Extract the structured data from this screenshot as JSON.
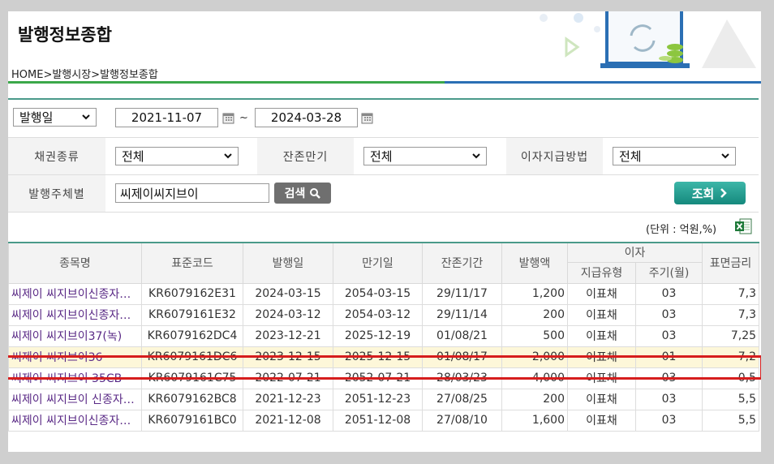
{
  "header": {
    "title": "발행정보종합",
    "breadcrumb": "HOME>발행시장>발행정보종합"
  },
  "filters": {
    "date_type": "발행일",
    "date_from": "2021-11-07",
    "date_sep": "~",
    "date_to": "2024-03-28",
    "bond_type_label": "채권종류",
    "bond_type_value": "전체",
    "remaining_label": "잔존만기",
    "remaining_value": "전체",
    "interest_method_label": "이자지급방법",
    "interest_method_value": "전체",
    "issuer_label": "발행주체별",
    "issuer_value": "씨제이씨지브이",
    "search_label": "검색",
    "query_label": "조회"
  },
  "unit_text": "(단위 : 억원,%)",
  "table": {
    "headers": {
      "name": "종목명",
      "code": "표준코드",
      "issue_date": "발행일",
      "maturity": "만기일",
      "remaining": "잔존기간",
      "amount": "발행액",
      "interest": "이자",
      "pay_type": "지급유형",
      "cycle": "주기(월)",
      "coupon": "표면금리"
    },
    "rows": [
      {
        "name": "씨제이 씨지브이신종자본증권",
        "code": "KR6079162E31",
        "issue_date": "2024-03-15",
        "maturity": "2054-03-15",
        "remaining": "29/11/17",
        "amount": "1,200",
        "pay_type": "이표채",
        "cycle": "03",
        "coupon": "7,3"
      },
      {
        "name": "씨제이 씨지브이신종자본증권",
        "code": "KR6079161E32",
        "issue_date": "2024-03-12",
        "maturity": "2054-03-12",
        "remaining": "29/11/14",
        "amount": "200",
        "pay_type": "이표채",
        "cycle": "03",
        "coupon": "7,3"
      },
      {
        "name": "씨제이 씨지브이37(녹)",
        "code": "KR6079162DC4",
        "issue_date": "2023-12-21",
        "maturity": "2025-12-19",
        "remaining": "01/08/21",
        "amount": "500",
        "pay_type": "이표채",
        "cycle": "03",
        "coupon": "7,25"
      },
      {
        "name": "씨제이 씨지브이36",
        "code": "KR6079161DC6",
        "issue_date": "2023-12-15",
        "maturity": "2025-12-15",
        "remaining": "01/08/17",
        "amount": "2,000",
        "pay_type": "이표채",
        "cycle": "01",
        "coupon": "7,2"
      },
      {
        "name": "씨제이 씨지브이 35CB",
        "code": "KR6079161C75",
        "issue_date": "2022-07-21",
        "maturity": "2052-07-21",
        "remaining": "28/03/23",
        "amount": "4,000",
        "pay_type": "이표채",
        "cycle": "03",
        "coupon": "0,5"
      },
      {
        "name": "씨제이 씨지브이 신종자본증권",
        "code": "KR6079162BC8",
        "issue_date": "2021-12-23",
        "maturity": "2051-12-23",
        "remaining": "27/08/25",
        "amount": "200",
        "pay_type": "이표채",
        "cycle": "03",
        "coupon": "5,5"
      },
      {
        "name": "씨제이 씨지브이신종자본증권",
        "code": "KR6079161BC0",
        "issue_date": "2021-12-08",
        "maturity": "2051-12-08",
        "remaining": "27/08/10",
        "amount": "1,600",
        "pay_type": "이표채",
        "cycle": "03",
        "coupon": "5,5"
      }
    ],
    "highlighted_row": 3
  },
  "colors": {
    "accent_green": "#3ca84a",
    "accent_blue": "#2b6fb4",
    "table_border_top": "#4a9a8a",
    "highlight_box": "#d61d1d",
    "link_text": "#5a2a86"
  }
}
